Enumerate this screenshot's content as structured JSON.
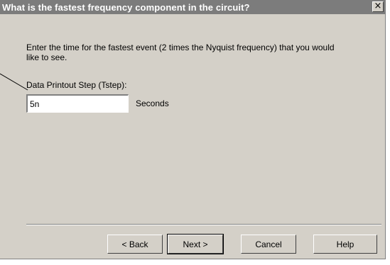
{
  "dialog": {
    "title": "What is the fastest frequency component in the circuit?",
    "close_glyph": "×"
  },
  "content": {
    "instructions": "Enter the time for the fastest event (2 times the Nyquist frequency) that you would like to see.",
    "step_label": "Data Printout Step (Tstep):",
    "tstep_value": "5n",
    "units": "Seconds"
  },
  "buttons": {
    "back": "< Back",
    "next": "Next >",
    "cancel": "Cancel",
    "help": "Help"
  }
}
